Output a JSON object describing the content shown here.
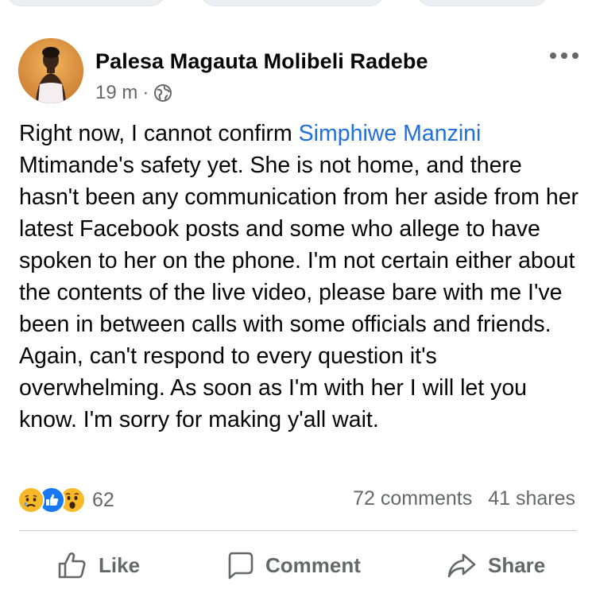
{
  "post": {
    "author": "Palesa Magauta Molibeli Radebe",
    "time": "19 m",
    "separator": "·",
    "privacy_icon": "globe-icon",
    "more_icon": "more-options-icon",
    "text_before_mention": "Right now, I cannot confirm ",
    "mention": "Simphiwe Manzini",
    "text_after_mention": " Mtimande's safety yet. She is not home, and there hasn't been any communication from her aside from her latest Facebook posts and some who allege to have spoken to her on the phone. I'm not certain either about the contents of the live video, please bare with me I've been in between calls with some officials and friends. Again, can't respond to every question it's overwhelming. As soon as I'm with her I will let you know. I'm sorry for making y'all wait.",
    "mention_color": "#216fdb"
  },
  "engagement": {
    "reactions": [
      "sad-reaction-icon",
      "like-reaction-icon",
      "wow-reaction-icon"
    ],
    "reaction_count": "62",
    "comments": "72 comments",
    "shares": "41 shares"
  },
  "actions": {
    "like_label": "Like",
    "comment_label": "Comment",
    "share_label": "Share"
  },
  "colors": {
    "text": "#050505",
    "secondary": "#65676b",
    "like_blue": "#1877f2",
    "reaction_yellow": "#f7b928"
  }
}
